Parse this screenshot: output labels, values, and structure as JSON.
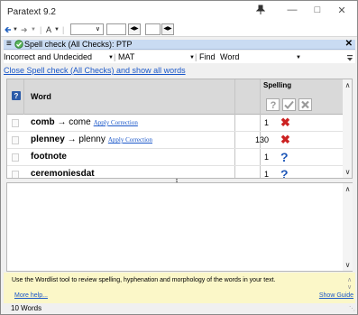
{
  "window": {
    "title": "Paratext 9.2",
    "pin_icon": "pin-icon",
    "minimize_icon": "minimize-icon",
    "maximize_icon": "maximize-icon",
    "close_icon": "close-icon"
  },
  "toolbar": {
    "back_icon": "back-arrow-icon",
    "forward_icon": "forward-arrow-icon",
    "font_size_label": "A"
  },
  "panel": {
    "title": "Spell check (All Checks): PTP",
    "menu_icon": "hamburger-menu-icon",
    "check_icon": "spellcheck-icon",
    "close_icon": "close-icon"
  },
  "filters": {
    "filter_value": "Incorrect and Undecided",
    "project_value": "MAT",
    "find_label": "Find",
    "find_value": "Word"
  },
  "close_link": "Close Spell check (All Checks) and show all words",
  "grid": {
    "column_word": "Word",
    "column_spelling": "Spelling",
    "apply_label": "Apply Correction",
    "colors": {
      "incorrect": "#cc2222",
      "unknown": "#1e57b8"
    },
    "rows": [
      {
        "word": "comb",
        "correction": "come",
        "count": "1",
        "status": "incorrect"
      },
      {
        "word": "plenney",
        "correction": "plenny",
        "count": "130",
        "status": "incorrect"
      },
      {
        "word": "footnote",
        "correction": "",
        "count": "1",
        "status": "unknown"
      },
      {
        "word": "ceremoniesdat",
        "correction": "",
        "count": "1",
        "status": "unknown"
      }
    ]
  },
  "help": {
    "text": "Use the Wordlist tool to review spelling, hyphenation and morphology of the words in your text.",
    "more_help": "More help...",
    "show_guide": "Show Guide"
  },
  "status_bar": {
    "word_count": "10 Words"
  }
}
